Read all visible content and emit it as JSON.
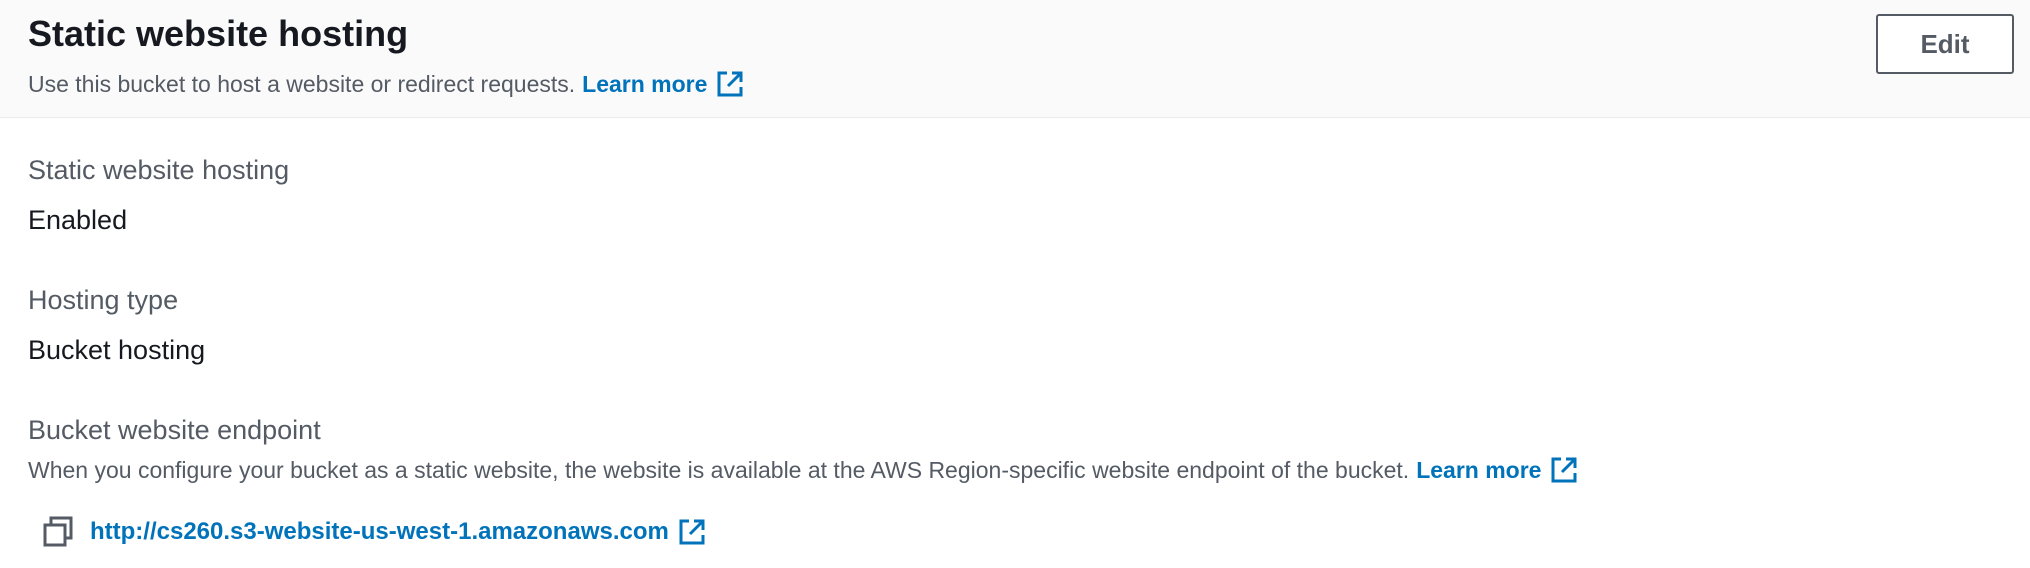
{
  "header": {
    "title": "Static website hosting",
    "description": "Use this bucket to host a website or redirect requests.",
    "learn_more": "Learn more",
    "edit_label": "Edit"
  },
  "fields": {
    "hosting": {
      "label": "Static website hosting",
      "value": "Enabled"
    },
    "hosting_type": {
      "label": "Hosting type",
      "value": "Bucket hosting"
    },
    "endpoint": {
      "label": "Bucket website endpoint",
      "description": "When you configure your bucket as a static website, the website is available at the AWS Region-specific website endpoint of the bucket.",
      "learn_more": "Learn more",
      "url": "http://cs260.s3-website-us-west-1.amazonaws.com"
    }
  },
  "icons": {
    "external": "external-link-icon",
    "copy": "copy-icon"
  },
  "colors": {
    "link": "#0073bb",
    "text": "#16191f",
    "secondary_text": "#545b64",
    "header_bg": "#fafafa"
  }
}
